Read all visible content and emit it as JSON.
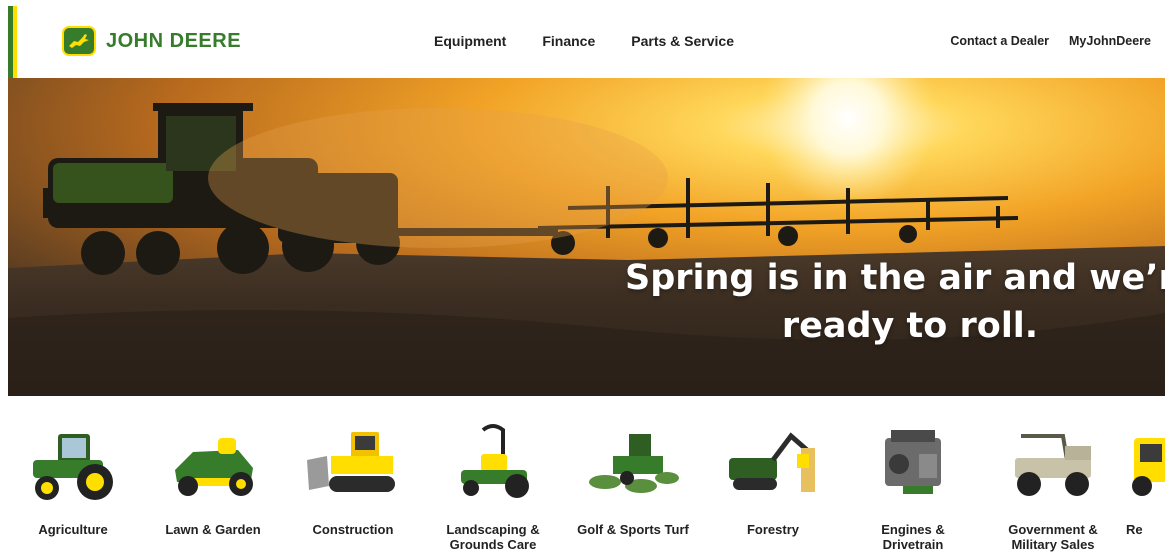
{
  "header": {
    "logo_text": "JOHN DEERE",
    "nav": [
      "Equipment",
      "Finance",
      "Parts & Service"
    ],
    "utility": [
      "Contact a Dealer",
      "MyJohnDeere"
    ]
  },
  "hero": {
    "headline_line1": "Spring is in the air and we’re",
    "headline_line2": "ready to roll."
  },
  "categories": [
    {
      "label": "Agriculture",
      "icon": "tractor-icon"
    },
    {
      "label": "Lawn & Garden",
      "icon": "riding-mower-icon"
    },
    {
      "label": "Construction",
      "icon": "bulldozer-icon"
    },
    {
      "label": "Landscaping &\nGrounds Care",
      "icon": "zero-turn-mower-icon"
    },
    {
      "label": "Golf & Sports Turf",
      "icon": "reel-mower-icon"
    },
    {
      "label": "Forestry",
      "icon": "harvester-icon"
    },
    {
      "label": "Engines &\nDrivetrain",
      "icon": "engine-icon"
    },
    {
      "label": "Government &\nMilitary Sales",
      "icon": "utility-vehicle-icon"
    },
    {
      "label": "Re",
      "icon": "skid-steer-icon"
    }
  ],
  "colors": {
    "brand_green": "#367C2B",
    "brand_yellow": "#FFDE00"
  }
}
